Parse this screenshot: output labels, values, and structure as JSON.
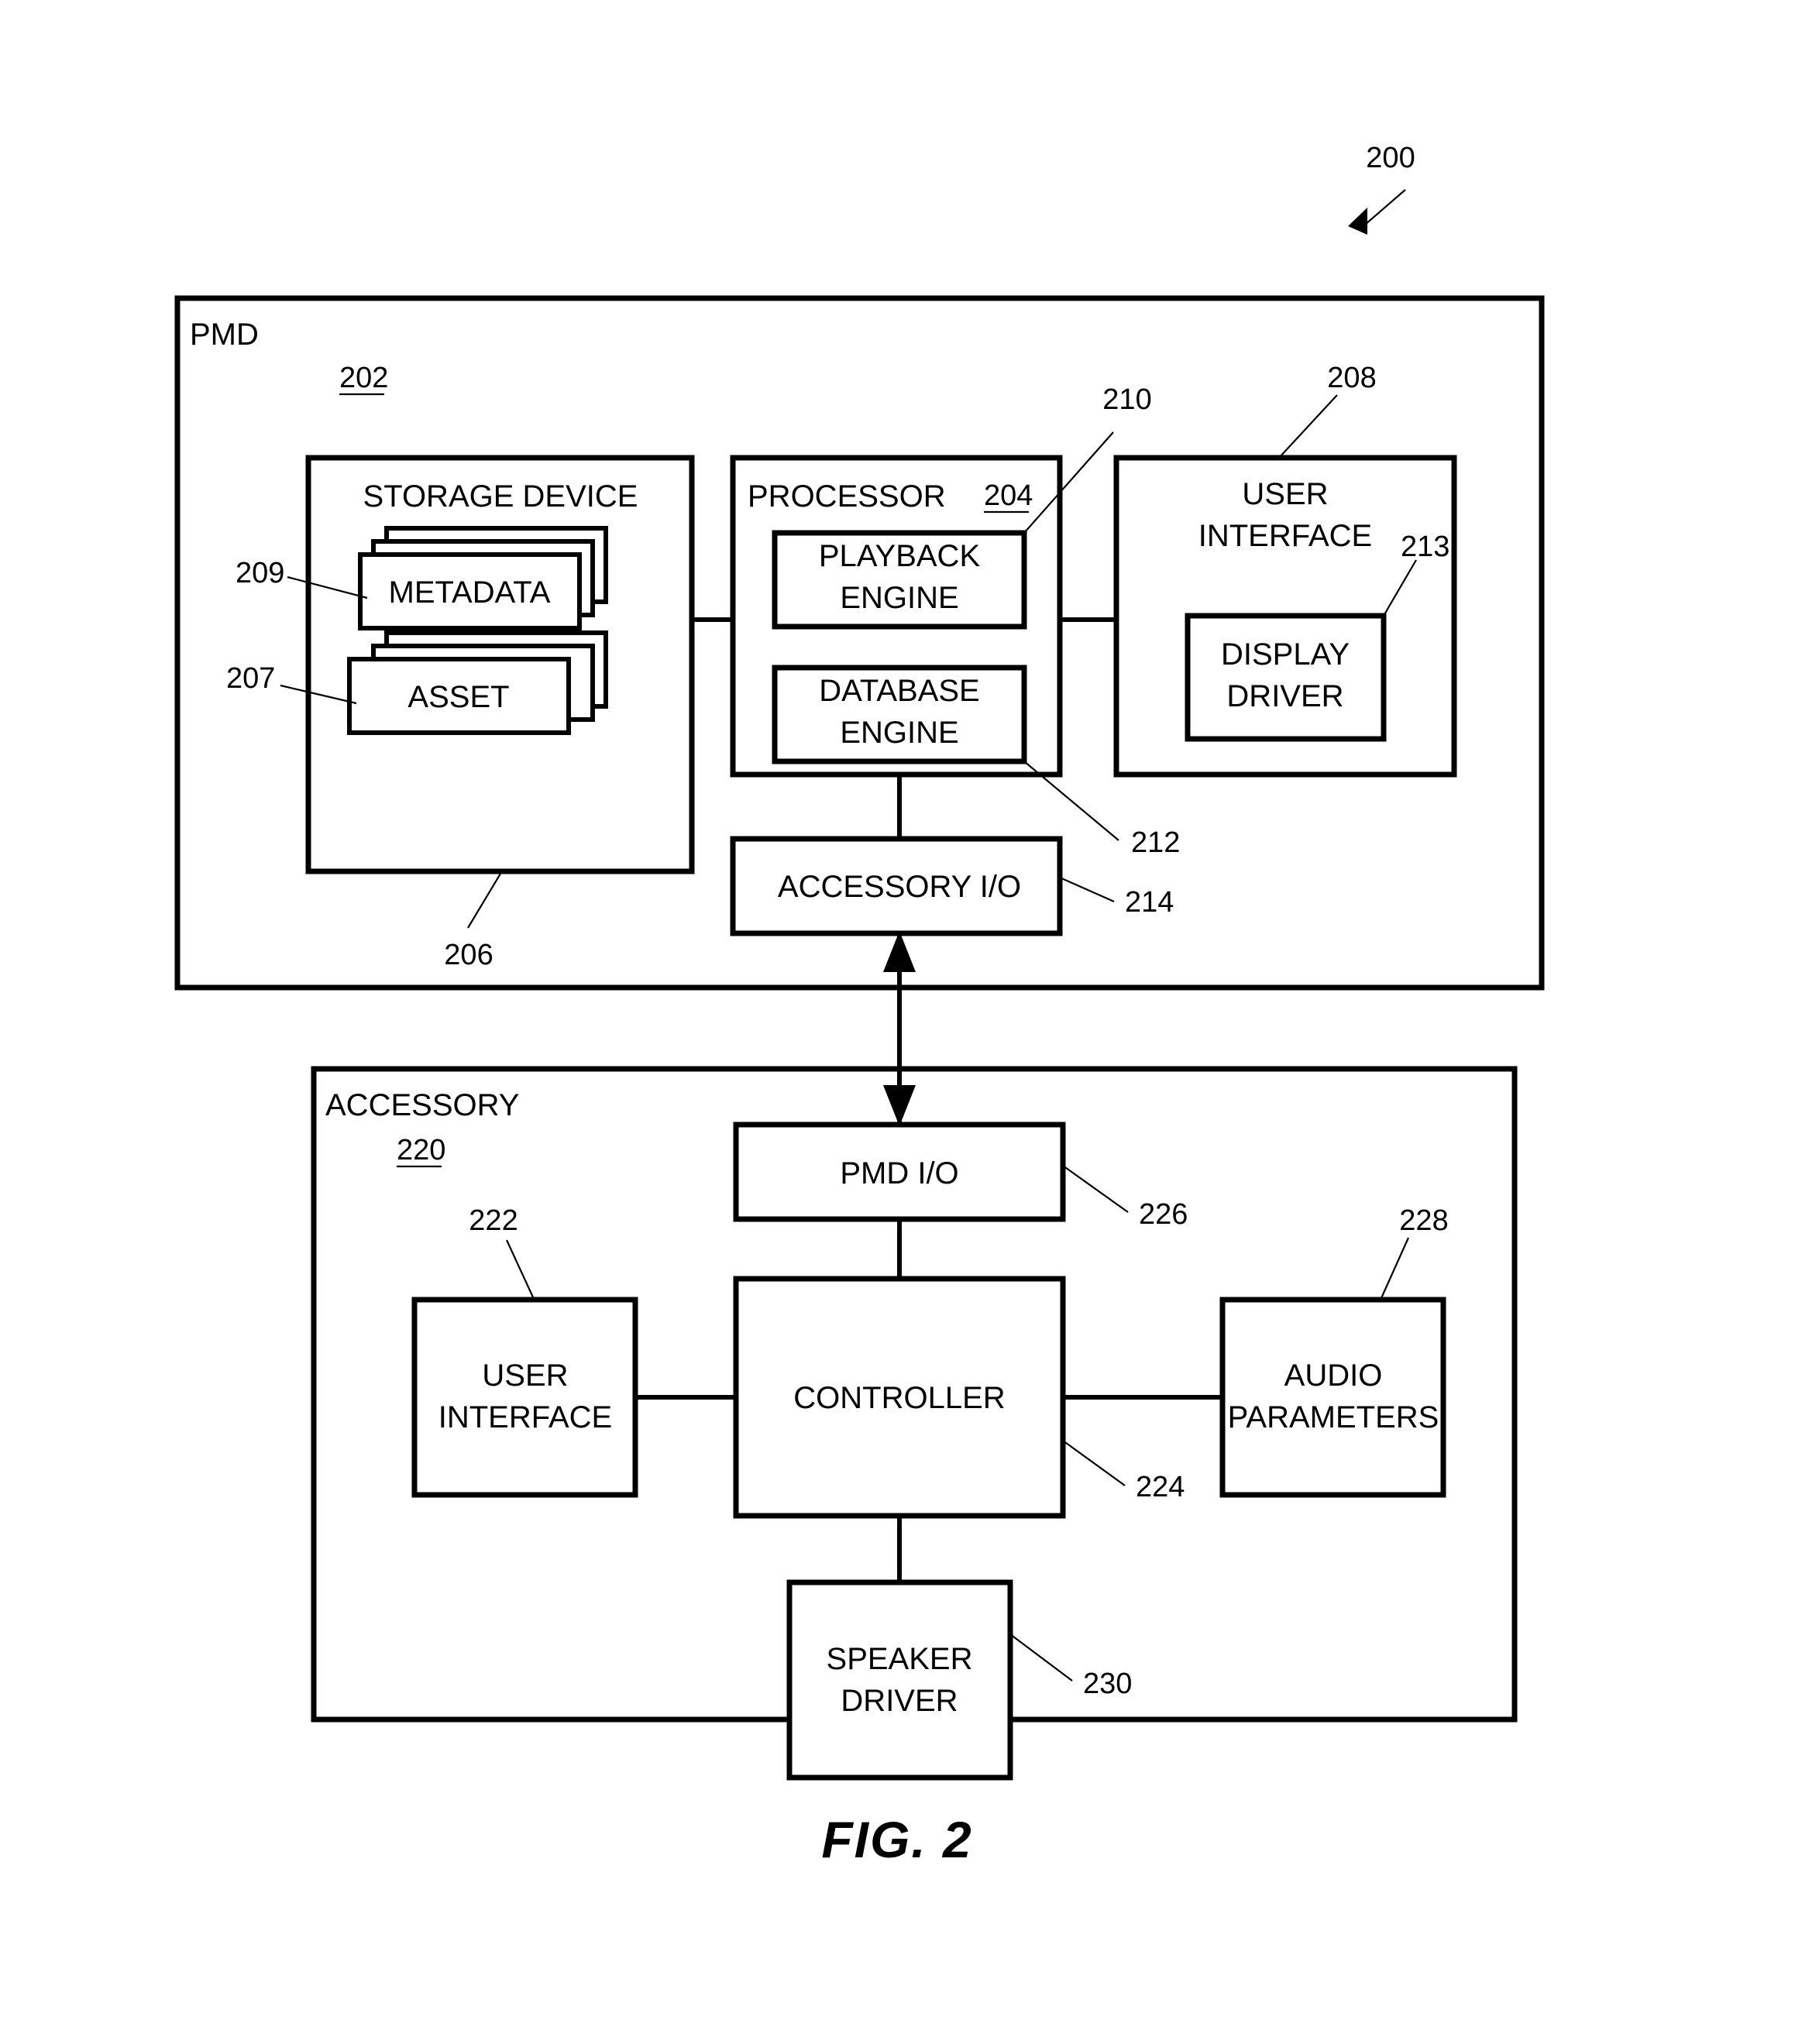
{
  "figure": {
    "caption": "FIG. 2",
    "system_ref": "200"
  },
  "pmd": {
    "title": "PMD",
    "ref": "202",
    "storage_device": {
      "label": "STORAGE DEVICE",
      "ref": "206",
      "metadata": {
        "label": "METADATA",
        "ref": "209"
      },
      "asset": {
        "label": "ASSET",
        "ref": "207"
      }
    },
    "processor": {
      "label": "PROCESSOR",
      "ref": "204",
      "playback_engine": {
        "label_line1": "PLAYBACK",
        "label_line2": "ENGINE",
        "ref": "210"
      },
      "database_engine": {
        "label_line1": "DATABASE",
        "label_line2": "ENGINE",
        "ref": "212"
      }
    },
    "user_interface": {
      "label_line1": "USER",
      "label_line2": "INTERFACE",
      "ref": "208",
      "display_driver": {
        "label_line1": "DISPLAY",
        "label_line2": "DRIVER",
        "ref": "213"
      }
    },
    "accessory_io": {
      "label": "ACCESSORY I/O",
      "ref": "214"
    }
  },
  "accessory": {
    "title": "ACCESSORY",
    "ref": "220",
    "pmd_io": {
      "label": "PMD I/O",
      "ref": "226"
    },
    "controller": {
      "label": "CONTROLLER",
      "ref": "224"
    },
    "user_interface": {
      "label_line1": "USER",
      "label_line2": "INTERFACE",
      "ref": "222"
    },
    "audio_parameters": {
      "label_line1": "AUDIO",
      "label_line2": "PARAMETERS",
      "ref": "228"
    },
    "speaker_driver": {
      "label_line1": "SPEAKER",
      "label_line2": "DRIVER",
      "ref": "230"
    }
  },
  "colors": {
    "ink": "#000000",
    "paper": "#ffffff"
  }
}
